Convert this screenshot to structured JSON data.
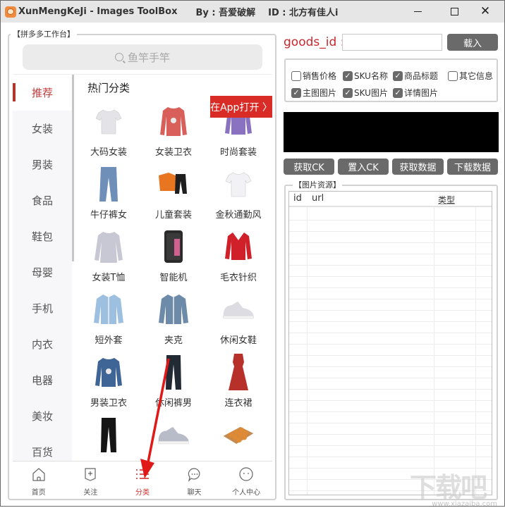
{
  "window": {
    "title": "XunMengKeJi - Images ToolBox",
    "by": "By : 吾爱破解",
    "id": "ID : 北方有佳人i",
    "controls": {
      "minimize": "minimize",
      "maximize": "maximize",
      "close": "close"
    }
  },
  "left": {
    "group_title": "【拼多多工作台】",
    "search_placeholder": "鱼竿手竿",
    "categories": [
      {
        "label": "推荐",
        "active": true
      },
      {
        "label": "女装"
      },
      {
        "label": "男装"
      },
      {
        "label": "食品"
      },
      {
        "label": "鞋包"
      },
      {
        "label": "母婴"
      },
      {
        "label": "手机"
      },
      {
        "label": "内衣"
      },
      {
        "label": "电器"
      },
      {
        "label": "美妆"
      },
      {
        "label": "百货"
      }
    ],
    "section_title": "热门分类",
    "open_app_label": "在App打开 〉",
    "items": [
      {
        "label": "大码女装",
        "icon": "tshirt-icon",
        "color": "#e4e4e8"
      },
      {
        "label": "女装卫衣",
        "icon": "sweatshirt-icon",
        "color": "#d9605a"
      },
      {
        "label": "时尚套装",
        "icon": "sweater-icon",
        "color": "#8a72c0"
      },
      {
        "label": "牛仔裤女",
        "icon": "jeans-icon",
        "color": "#6f8fb8"
      },
      {
        "label": "儿童套装",
        "icon": "kids-set-icon",
        "color": "#e8751f"
      },
      {
        "label": "金秋通勤风",
        "icon": "tshirt-icon",
        "color": "#f2f2f6"
      },
      {
        "label": "女装T恤",
        "icon": "longsleeve-icon",
        "color": "#c8c8d4"
      },
      {
        "label": "智能机",
        "icon": "phone-icon",
        "color": "#2a2a2a"
      },
      {
        "label": "毛衣针织",
        "icon": "sweater-icon",
        "color": "#d0202a"
      },
      {
        "label": "短外套",
        "icon": "jacket-icon",
        "color": "#9dbfe0"
      },
      {
        "label": "夹克",
        "icon": "jacket-icon",
        "color": "#6d8aa8"
      },
      {
        "label": "休闲女鞋",
        "icon": "sneaker-icon",
        "color": "#dcdce2"
      },
      {
        "label": "男装卫衣",
        "icon": "sweatshirt-icon",
        "color": "#3f6596"
      },
      {
        "label": "休闲裤男",
        "icon": "pants-icon",
        "color": "#222a33"
      },
      {
        "label": "连衣裙",
        "icon": "dress-icon",
        "color": "#b8302a"
      },
      {
        "label": "",
        "icon": "pants-icon",
        "color": "#151515"
      },
      {
        "label": "",
        "icon": "sneaker-icon",
        "color": "#b8bcc8"
      },
      {
        "label": "",
        "icon": "food-tray-icon",
        "color": "#e08a34"
      }
    ],
    "bottom_nav": [
      {
        "label": "首页",
        "icon": "home-icon"
      },
      {
        "label": "关注",
        "icon": "follow-icon"
      },
      {
        "label": "分类",
        "icon": "category-list-icon",
        "active": true
      },
      {
        "label": "聊天",
        "icon": "chat-icon"
      },
      {
        "label": "个人中心",
        "icon": "profile-icon"
      }
    ]
  },
  "right": {
    "goods_id_label": "goods_id :",
    "goods_id_value": "",
    "load_label": "载入",
    "checkboxes": [
      {
        "label": "销售价格",
        "checked": false
      },
      {
        "label": "SKU名称",
        "checked": true
      },
      {
        "label": "商品标题",
        "checked": true
      },
      {
        "label": "其它信息",
        "checked": false
      },
      {
        "label": "主图图片",
        "checked": true
      },
      {
        "label": "SKU图片",
        "checked": true
      },
      {
        "label": "详情图片",
        "checked": true
      }
    ],
    "buttons": {
      "get_ck": "获取CK",
      "set_ck": "置入CK",
      "get_data": "获取数据",
      "download_data": "下载数据"
    },
    "image_group_title": "【图片资源】",
    "table": {
      "columns": [
        "id",
        "url",
        "类型"
      ],
      "rows": []
    }
  },
  "watermark": {
    "text": "下载吧",
    "url": "www.xiazaiba.com"
  },
  "colors": {
    "accent_red": "#c8282d",
    "button_gray": "#6b6a6a",
    "active_tab": "#b3332f"
  }
}
